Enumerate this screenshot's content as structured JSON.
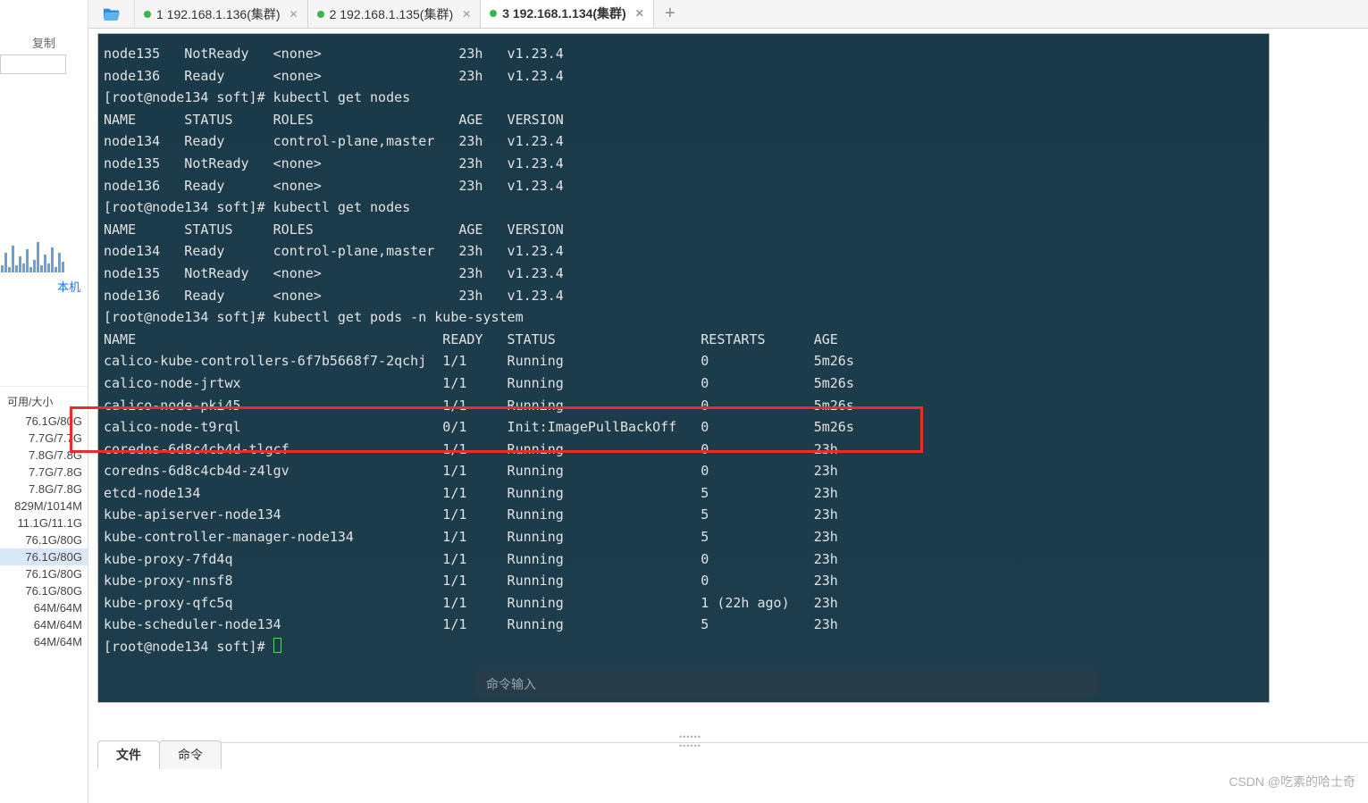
{
  "left": {
    "copy_label": "复制",
    "local_label": "本机",
    "usage_header": "可用/大小",
    "usage": [
      "76.1G/80G",
      "7.7G/7.7G",
      "7.8G/7.8G",
      "7.7G/7.8G",
      "7.8G/7.8G",
      "829M/1014M",
      "11.1G/11.1G",
      "76.1G/80G",
      "76.1G/80G",
      "76.1G/80G",
      "76.1G/80G",
      "64M/64M",
      "64M/64M",
      "64M/64M"
    ],
    "selected_index": 8
  },
  "tabs": [
    {
      "label": "1 192.168.1.136(集群)",
      "active": false
    },
    {
      "label": "2 192.168.1.135(集群)",
      "active": false
    },
    {
      "label": "3 192.168.1.134(集群)",
      "active": true
    }
  ],
  "terminal": {
    "lines": [
      "node135   NotReady   <none>                 23h   v1.23.4",
      "node136   Ready      <none>                 23h   v1.23.4",
      "[root@node134 soft]# kubectl get nodes",
      "NAME      STATUS     ROLES                  AGE   VERSION",
      "node134   Ready      control-plane,master   23h   v1.23.4",
      "node135   NotReady   <none>                 23h   v1.23.4",
      "node136   Ready      <none>                 23h   v1.23.4",
      "[root@node134 soft]# kubectl get nodes",
      "NAME      STATUS     ROLES                  AGE   VERSION",
      "node134   Ready      control-plane,master   23h   v1.23.4",
      "node135   NotReady   <none>                 23h   v1.23.4",
      "node136   Ready      <none>                 23h   v1.23.4",
      "[root@node134 soft]# kubectl get pods -n kube-system",
      "NAME                                      READY   STATUS                  RESTARTS      AGE",
      "calico-kube-controllers-6f7b5668f7-2qchj  1/1     Running                 0             5m26s",
      "calico-node-jrtwx                         1/1     Running                 0             5m26s",
      "calico-node-pki45                         1/1     Running                 0             5m26s",
      "calico-node-t9rql                         0/1     Init:ImagePullBackOff   0             5m26s",
      "coredns-6d8c4cb4d-tlgcf                   1/1     Running                 0             23h",
      "coredns-6d8c4cb4d-z4lgv                   1/1     Running                 0             23h",
      "etcd-node134                              1/1     Running                 5             23h",
      "kube-apiserver-node134                    1/1     Running                 5             23h",
      "kube-controller-manager-node134           1/1     Running                 5             23h",
      "kube-proxy-7fd4q                          1/1     Running                 0             23h",
      "kube-proxy-nnsf8                          1/1     Running                 0             23h",
      "kube-proxy-qfc5q                          1/1     Running                 1 (22h ago)   23h",
      "kube-scheduler-node134                    1/1     Running                 5             23h",
      "[root@node134 soft]# "
    ],
    "cmd_placeholder": "命令输入"
  },
  "bottom_tabs": {
    "file": "文件",
    "cmd": "命令"
  },
  "watermark": "CSDN @吃素的哈士奇"
}
